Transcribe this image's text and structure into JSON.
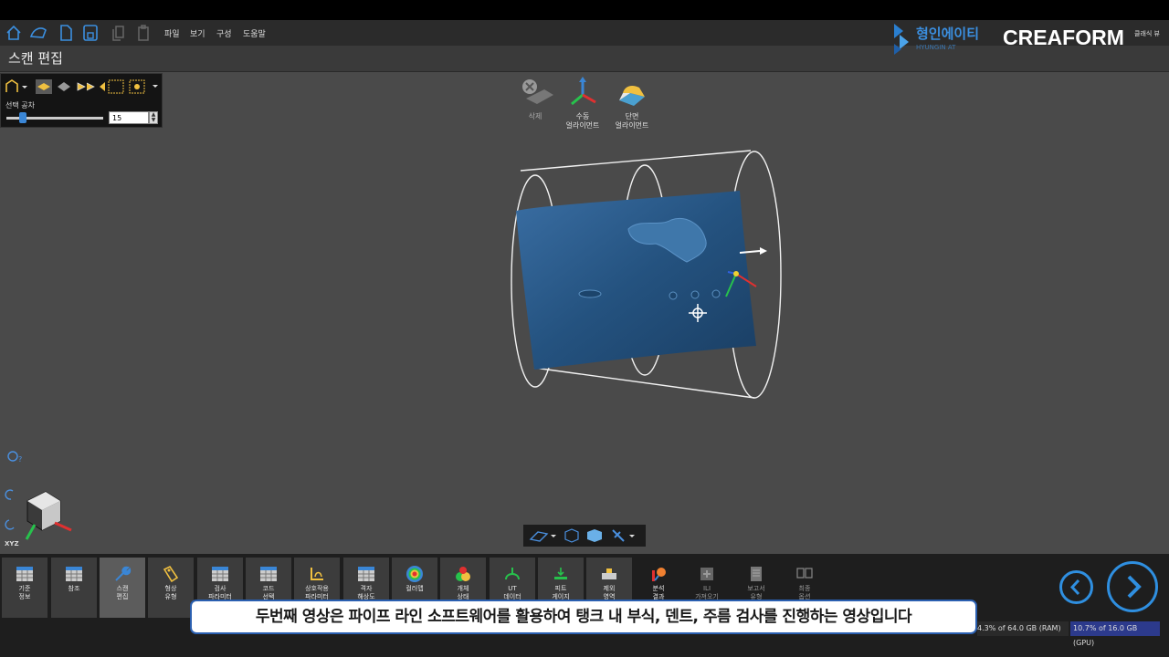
{
  "toolbar": {
    "menus": [
      "파일",
      "보기",
      "구성",
      "도움말"
    ]
  },
  "branding": {
    "partner_logo": "형인에이티",
    "partner_logo_sub": "HYUNGIN AT",
    "brand": "CREAFORM",
    "view_mode": "클래식 뷰"
  },
  "page": {
    "title": "스캔 편집"
  },
  "selection_panel": {
    "label": "선택 공차",
    "tolerance_value": "15",
    "slider_level_fraction": 0.17
  },
  "float_tools": [
    {
      "label": "삭제",
      "icon": "delete-cut-icon",
      "enabled": false
    },
    {
      "label": "수동\n얼라이먼트",
      "icon": "axes-align-icon",
      "enabled": true
    },
    {
      "label": "단면\n얼라이먼트",
      "icon": "section-align-icon",
      "enabled": true
    }
  ],
  "ribbon": [
    {
      "label": "기준\n정보",
      "icon": "table-icon"
    },
    {
      "label": "참조",
      "icon": "table-icon"
    },
    {
      "label": "스캔\n편집",
      "icon": "wrench-icon",
      "active": true
    },
    {
      "label": "형상\n유형",
      "icon": "tag-icon"
    },
    {
      "label": "검사\n파라미터",
      "icon": "table-icon"
    },
    {
      "label": "코드\n선택",
      "icon": "table-icon"
    },
    {
      "label": "상호작용\n파라미터",
      "icon": "interaction-icon"
    },
    {
      "label": "격자\n해상도",
      "icon": "table-icon"
    },
    {
      "label": "컬러맵",
      "icon": "colormap-icon"
    },
    {
      "label": "개체\n상태",
      "icon": "object-status-icon"
    },
    {
      "label": "UT\n데이터",
      "icon": "ut-data-icon"
    },
    {
      "label": "피트\n게이지",
      "icon": "pit-gauge-icon"
    },
    {
      "label": "제외\n영역",
      "icon": "exclude-zone-icon"
    },
    {
      "label": "분석\n결과",
      "icon": "analysis-icon",
      "plain": true
    },
    {
      "label": "ILI\n가져오기",
      "icon": "ili-import-icon",
      "plain": true,
      "dim": true
    },
    {
      "label": "보고서\n유형",
      "icon": "report-icon",
      "plain": true,
      "dim": true
    },
    {
      "label": "최종\n옵션",
      "icon": "final-options-icon",
      "plain": true,
      "dim": true
    }
  ],
  "status": {
    "ram": "4.3% of 64.0 GB (RAM)",
    "gpu": "10.7% of 16.0 GB (GPU)"
  },
  "subtitle": "두번째 영상은 파이프 라인 소프트웨어를 활용하여 탱크 내 부식, 덴트, 주름 검사를 진행하는 영상입니다",
  "orientation": {
    "label": "XYZ"
  },
  "colors": {
    "accent": "#2f8fe0",
    "scan_blue": "#2c5a8a",
    "viewport_bg": "#4a4a4a"
  }
}
